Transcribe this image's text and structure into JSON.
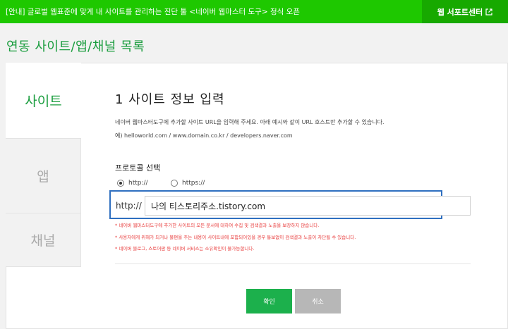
{
  "topbar": {
    "notice": "[안내] 글로벌 웹표준에 맞게 내 사이트를 관리하는 진단 툴 <네이버 웹마스터 도구> 정식 오픈",
    "webmaster_center": "웹 서포트센터"
  },
  "page_title": "연동 사이트/앱/채널 목록",
  "tabs": [
    {
      "label": "사이트",
      "active": true
    },
    {
      "label": "앱",
      "active": false
    },
    {
      "label": "채널",
      "active": false
    }
  ],
  "form": {
    "section_title": "1 사이트 정보 입력",
    "description": "네이버 웹마스터도구에 추가할 사이트 URL을 입력해 주세요. 아래 예시와 같이 URL 호스트만 추가할 수 있습니다.",
    "example": "예) helloworld.com / www.domain.co.kr / developers.naver.com",
    "protocol_label": "프로토콜 선택",
    "protocol_options": [
      "http://",
      "https://"
    ],
    "protocol_selected": "http://",
    "url_prefix": "http://",
    "url_value": "나의 티스토리주소.tistory.com",
    "warnings": [
      "* 네이버 웹마스터도구에 추가한 사이트의 모든 문서에 대하여 수집 및 검색결과 노출을 보장하지 않습니다.",
      "* 사용자에게 위해가 되거나 불편을 주는 내용이 사이트내에 포함되어있을 경우 통보없이 검색결과 노출이 차단될 수 있습니다.",
      "* 네이버 블로그, 스토어팜 등 네이버 서비스는 소유확인이 불가능합니다."
    ]
  },
  "buttons": {
    "confirm": "확인",
    "cancel": "취소"
  },
  "colors": {
    "brand_green": "#1ec800",
    "highlight_blue": "#2f6fc0",
    "warning_red": "#e83a3a"
  }
}
